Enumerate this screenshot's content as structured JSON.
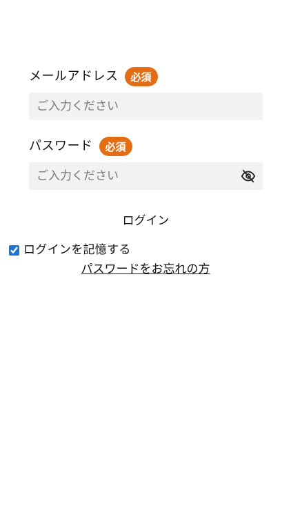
{
  "email": {
    "label": "メールアドレス",
    "required_badge": "必須",
    "placeholder": "ご入力ください",
    "value": ""
  },
  "password": {
    "label": "パスワード",
    "required_badge": "必須",
    "placeholder": "ご入力ください",
    "value": "",
    "toggle_icon": "eye-slash-icon"
  },
  "login": {
    "button_label": "ログイン"
  },
  "remember": {
    "label": "ログインを記憶する",
    "checked": true
  },
  "forgot": {
    "link_text": "パスワードをお忘れの方"
  },
  "colors": {
    "badge": "#e26d14",
    "input_bg": "#f2f2f2",
    "checkbox": "#1976d2"
  }
}
